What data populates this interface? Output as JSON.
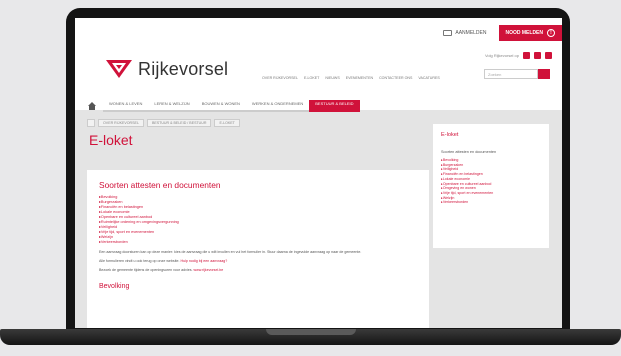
{
  "header": {
    "login_label": "AANMELDEN",
    "alert_label": "NOOD MELDEN",
    "social_label": "Volg Rijkevorsel op",
    "logo_name": "Rijkevorsel",
    "search_placeholder": "Zoeken",
    "main_nav": [
      "Over Rijkevorsel",
      "E-loket",
      "Nieuws",
      "Evenementen",
      "Contacteer ons",
      "Vacatures"
    ]
  },
  "tabs": [
    "Wonen & Leven",
    "Leren & Welzijn",
    "Bouwen & Wonen",
    "Werken & Ondernemen",
    "Bestuur & Beleid"
  ],
  "breadcrumb": [
    "Over Rijkevorsel",
    "Bestuur & Beleid / Bestuur",
    "E-loket"
  ],
  "page": {
    "title": "E-loket",
    "heading": "Soorten attesten en documenten",
    "items": [
      "Bevolking",
      "Burgerzaken",
      "Financiën en belastingen",
      "Lokale economie",
      "Openbare en cultureel aanbod",
      "Ruimtelijke ordening en omgevingsvergunning",
      "Veiligheid",
      "Vrije tijd, sport en evenementen",
      "Welzijn",
      "Verkeersborden"
    ],
    "para1": "Een aanvraag doorsturen kan op deze manier: kies de aanvraag die u wilt invullen en vul het formulier in. Stuur daarna de ingevulde aanvraag op naar de gemeente.",
    "para2_prefix": "Alle formulieren vindt u ook terug op onze website.",
    "para2_link": "Hulp nodig bij een aanvraag?",
    "para3_prefix": "Bezoek de gemeente tijdens de openingsuren voor advies.",
    "para3_link": "www.rijkevorsel.be",
    "section2": "Bevolking"
  },
  "sidebar": {
    "title": "E-loket",
    "intro": "Soorten attesten en documenten",
    "items": [
      "Bevolking",
      "Burgerzaken",
      "Veiligheid",
      "Financiën en belastingen",
      "Lokale economie",
      "Openbare en cultureel aanbod",
      "Omgeving en wonen",
      "Vrije tijd, sport en evenementen",
      "Welzijn",
      "Verkeersborden"
    ]
  }
}
